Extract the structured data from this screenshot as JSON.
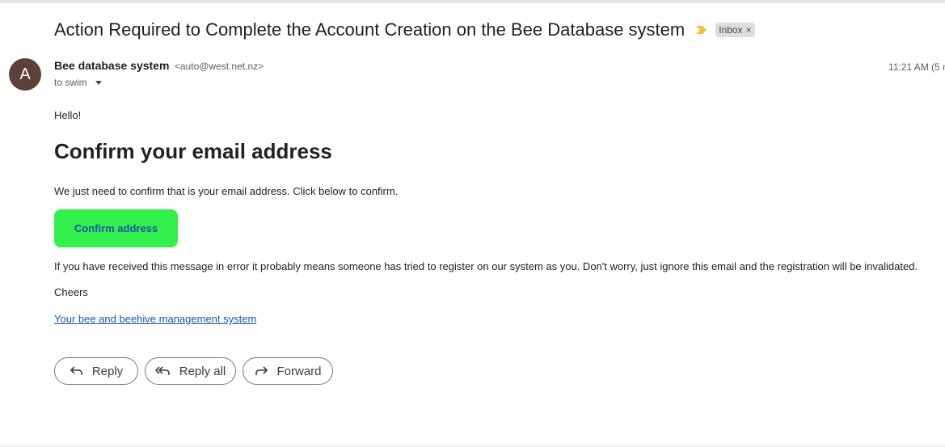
{
  "email": {
    "subject": "Action Required to Complete the Account Creation on the Bee Database system",
    "label": "Inbox",
    "label_close": "×",
    "avatar_letter": "A",
    "sender_name": "Bee database system",
    "sender_email": "<auto@west.net.nz>",
    "to": "to swim",
    "timestamp": "11:21 AM (5 m"
  },
  "body": {
    "greeting": "Hello!",
    "headline": "Confirm your email address",
    "intro": "We just need to confirm that is your email address. Click below to confirm.",
    "confirm_button": "Confirm address",
    "error_note": "If you have received this message in error it probably means someone has tried to register on our system as you. Don't worry, just ignore this email and the registration will be invalidated.",
    "signoff": "Cheers",
    "signature_link": "Your bee and beehive management system"
  },
  "actions": {
    "reply": "Reply",
    "reply_all": "Reply all",
    "forward": "Forward"
  },
  "colors": {
    "avatar_bg": "#5d4037",
    "confirm_bg": "#33f04d",
    "confirm_text": "#1a56a8",
    "important_marker": "#f2c036",
    "link": "#1a55b5"
  },
  "icons": {
    "important": "important-marker-icon",
    "reply": "reply-arrow-icon",
    "reply_all": "reply-all-arrow-icon",
    "forward": "forward-arrow-icon"
  }
}
